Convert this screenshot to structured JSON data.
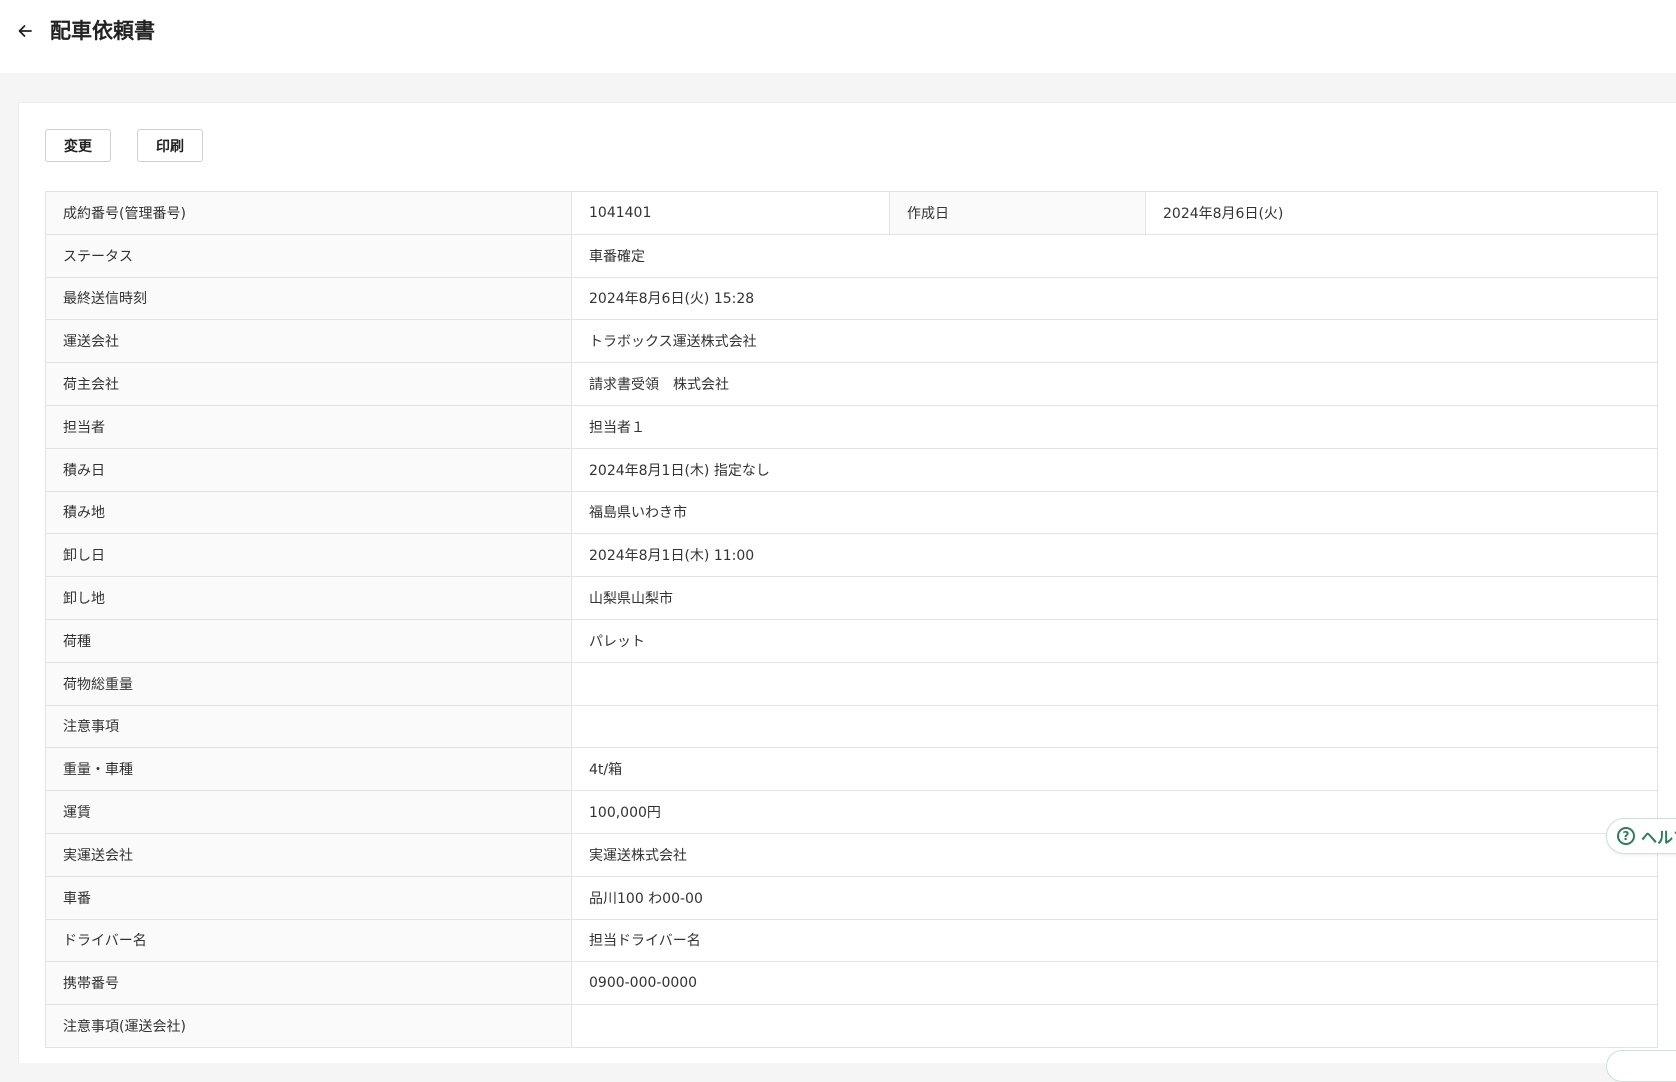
{
  "header": {
    "title": "配車依頼書",
    "back_icon": "arrow-left-icon"
  },
  "toolbar": {
    "change_label": "変更",
    "print_label": "印刷"
  },
  "detail": {
    "first_row": {
      "label": "成約番号(管理番号)",
      "value": "1041401",
      "label2": "作成日",
      "value2": "2024年8月6日(火)"
    },
    "rows": [
      {
        "label": "ステータス",
        "value": "車番確定"
      },
      {
        "label": "最終送信時刻",
        "value": "2024年8月6日(火) 15:28"
      },
      {
        "label": "運送会社",
        "value": "トラボックス運送株式会社"
      },
      {
        "label": "荷主会社",
        "value": "請求書受領　株式会社"
      },
      {
        "label": "担当者",
        "value": "担当者１"
      },
      {
        "label": "積み日",
        "value": "2024年8月1日(木) 指定なし"
      },
      {
        "label": "積み地",
        "value": "福島県いわき市"
      },
      {
        "label": "卸し日",
        "value": "2024年8月1日(木) 11:00"
      },
      {
        "label": "卸し地",
        "value": "山梨県山梨市"
      },
      {
        "label": "荷種",
        "value": "パレット"
      },
      {
        "label": "荷物総重量",
        "value": ""
      },
      {
        "label": "注意事項",
        "value": ""
      },
      {
        "label": "重量・車種",
        "value": "4t/箱"
      },
      {
        "label": "運賃",
        "value": "100,000円"
      },
      {
        "label": "実運送会社",
        "value": "実運送株式会社"
      },
      {
        "label": "車番",
        "value": "品川100 わ00-00"
      },
      {
        "label": "ドライバー名",
        "value": "担当ドライバー名"
      },
      {
        "label": "携帯番号",
        "value": "0900-000-0000"
      },
      {
        "label": "注意事項(運送会社)",
        "value": ""
      }
    ]
  },
  "help": {
    "label": "ヘルプ",
    "icon": "question-circle-icon",
    "color": "#2e7d5b"
  }
}
